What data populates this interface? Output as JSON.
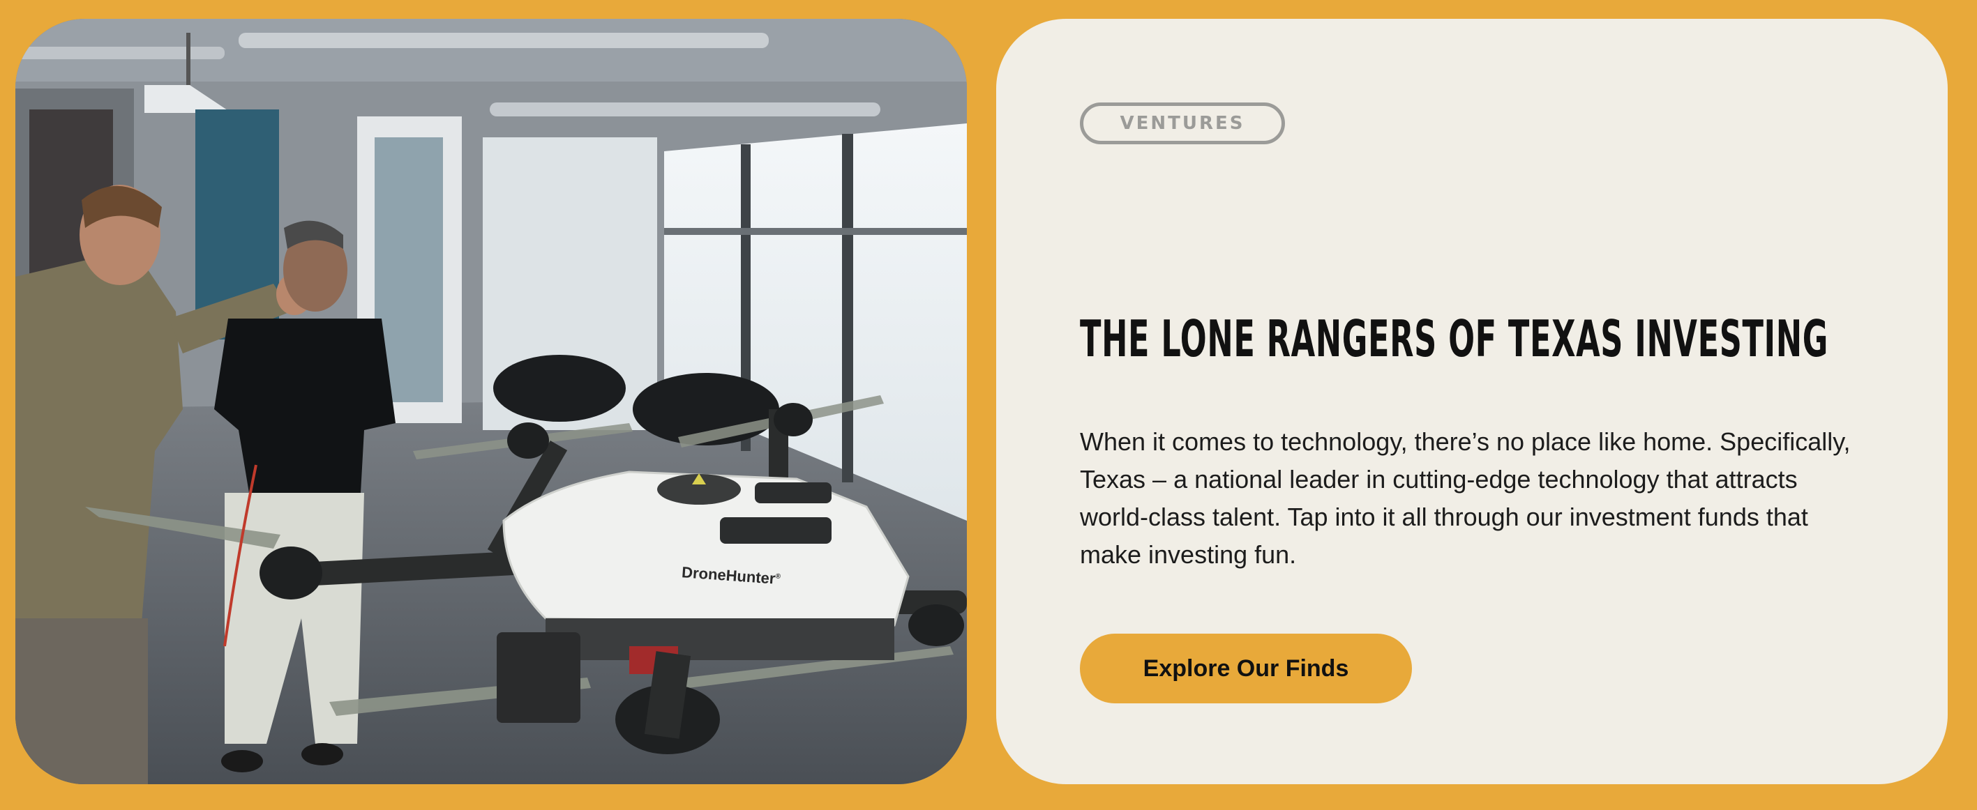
{
  "photo": {
    "drone_label": "DroneHunter",
    "drone_label_mark": "®"
  },
  "card": {
    "tag": "VENTURES",
    "headline": "THE LONE RANGERS OF TEXAS INVESTING",
    "body": "When it comes to technology, there’s no place like home. Specifically, Texas – a national leader in cutting-edge technology that attracts world-class talent. Tap into it all through our investment funds that make investing fun.",
    "cta_label": "Explore Our Finds"
  },
  "colors": {
    "background": "#E8A93A",
    "card": "#F1EEE6",
    "accent": "#E8A93A",
    "headline": "#111111",
    "tag_border": "#9B9B98"
  }
}
